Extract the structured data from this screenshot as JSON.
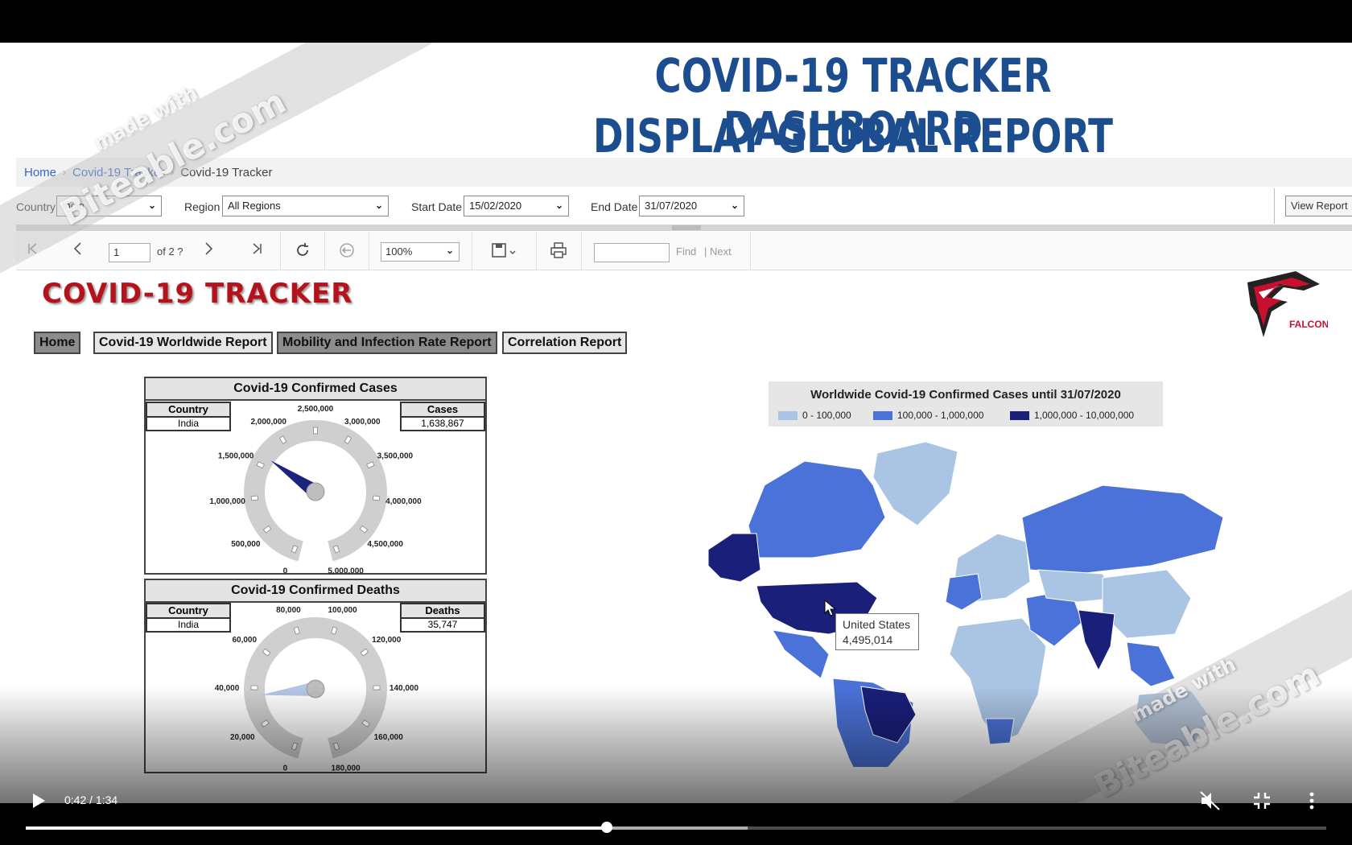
{
  "headline": {
    "line1": "COVID-19 TRACKER DASHBOARD",
    "line2": "DISPLAY GLOBAL REPORT"
  },
  "breadcrumb": {
    "items": [
      "Home",
      "Covid-19 Tracker",
      "Covid-19 Tracker"
    ]
  },
  "params": {
    "country_label": "Country",
    "country_value": "India",
    "region_label": "Region",
    "region_value": "All Regions",
    "start_label": "Start Date",
    "start_value": "15/02/2020",
    "end_label": "End Date",
    "end_value": "31/07/2020",
    "view_report": "View Report"
  },
  "toolbar": {
    "page_value": "1",
    "page_of": "of 2 ?",
    "zoom_value": "100%",
    "find_label": "Find",
    "next_label": "| Next",
    "icons": [
      "first-page-icon",
      "prev-page-icon",
      "next-page-icon",
      "last-page-icon",
      "refresh-icon",
      "back-icon",
      "save-icon",
      "print-icon"
    ]
  },
  "report": {
    "title": "COVID-19 TRACKER",
    "nav": [
      "Home",
      "Covid-19 Worldwide Report",
      "Mobility and Infection Rate Report",
      "Correlation Report"
    ],
    "logo_text": "FALCON"
  },
  "confirmed_gauge": {
    "title": "Covid-19 Confirmed Cases",
    "country_header": "Country",
    "country_value": "India",
    "value_header": "Cases",
    "value": "1,638,867",
    "numeric_value": 1638867,
    "min": 0,
    "max": 5000000,
    "tick_labels": [
      "0",
      "500,000",
      "1,000,000",
      "1,500,000",
      "2,000,000",
      "2,500,000",
      "3,000,000",
      "3,500,000",
      "4,000,000",
      "4,500,000",
      "5,000,000"
    ],
    "needle_color": "#1a237e"
  },
  "deaths_gauge": {
    "title": "Covid-19 Confirmed Deaths",
    "country_header": "Country",
    "country_value": "India",
    "value_header": "Deaths",
    "value": "35,747",
    "numeric_value": 35747,
    "min": 0,
    "max": 180000,
    "tick_labels": [
      "0",
      "20,000",
      "40,000",
      "60,000",
      "80,000",
      "100,000",
      "120,000",
      "140,000",
      "160,000",
      "180,000"
    ],
    "needle_color": "#b3c7e6"
  },
  "map": {
    "title": "Worldwide Covid-19 Confirmed Cases until 31/07/2020",
    "legend": [
      {
        "label": "0 - 100,000",
        "color": "#aac4e4"
      },
      {
        "label": "100,000 - 1,000,000",
        "color": "#4a72d8"
      },
      {
        "label": "1,000,000 - 10,000,000",
        "color": "#1a1f7a"
      }
    ],
    "tooltip_country": "United States",
    "tooltip_value": "4,495,014"
  },
  "watermark": {
    "line1": "made with",
    "line2": "Biteable.com"
  },
  "player": {
    "time": "0:42 / 1:34",
    "played_fraction": 0.4468,
    "buffered_fraction": 0.555
  }
}
